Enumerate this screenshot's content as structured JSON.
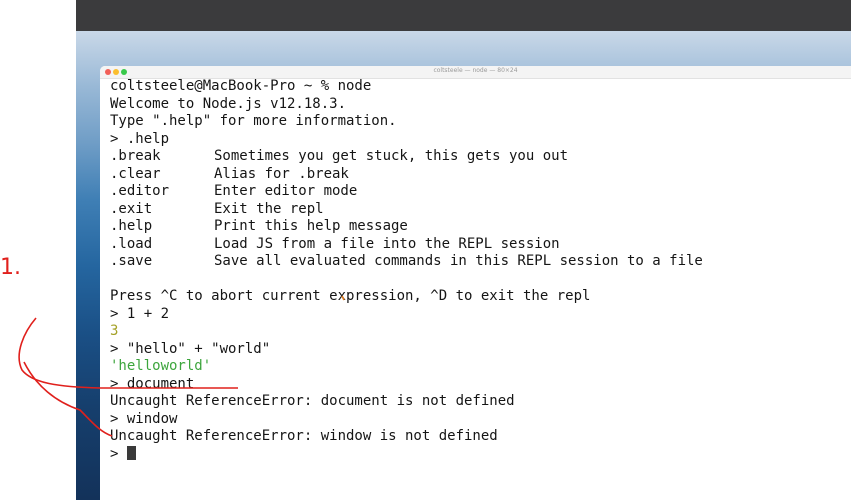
{
  "window": {
    "title": "coltsteele — node — 80×24"
  },
  "annotation_mark": "1.",
  "terminal": {
    "lines": {
      "prompt_node": "coltsteele@MacBook-Pro ~ % node",
      "welcome": "Welcome to Node.js v12.18.3.",
      "type_help": "Type \".help\" for more information.",
      "help_cmd": "> .help",
      "press_c": "Press ^C to abort current expression, ^D to exit the repl",
      "expr1": "> 1 + 2",
      "result1": "3",
      "expr2": "> \"hello\" + \"world\"",
      "result2": "'helloworld'",
      "expr3": "> document",
      "error1": "Uncaught ReferenceError: document is not defined",
      "expr4": "> window",
      "error2": "Uncaught ReferenceError: window is not defined",
      "prompt": "> "
    },
    "help_entries": [
      {
        "cmd": ".break",
        "desc": "Sometimes you get stuck, this gets you out"
      },
      {
        "cmd": ".clear",
        "desc": "Alias for .break"
      },
      {
        "cmd": ".editor",
        "desc": "Enter editor mode"
      },
      {
        "cmd": ".exit",
        "desc": "Exit the repl"
      },
      {
        "cmd": ".help",
        "desc": "Print this help message"
      },
      {
        "cmd": ".load",
        "desc": "Load JS from a file into the REPL session"
      },
      {
        "cmd": ".save",
        "desc": "Save all evaluated commands in this REPL session to a file"
      }
    ]
  },
  "colors": {
    "number_output": "#a4a127",
    "string_output": "#3da53d",
    "annotation_ink": "#e0201c"
  }
}
